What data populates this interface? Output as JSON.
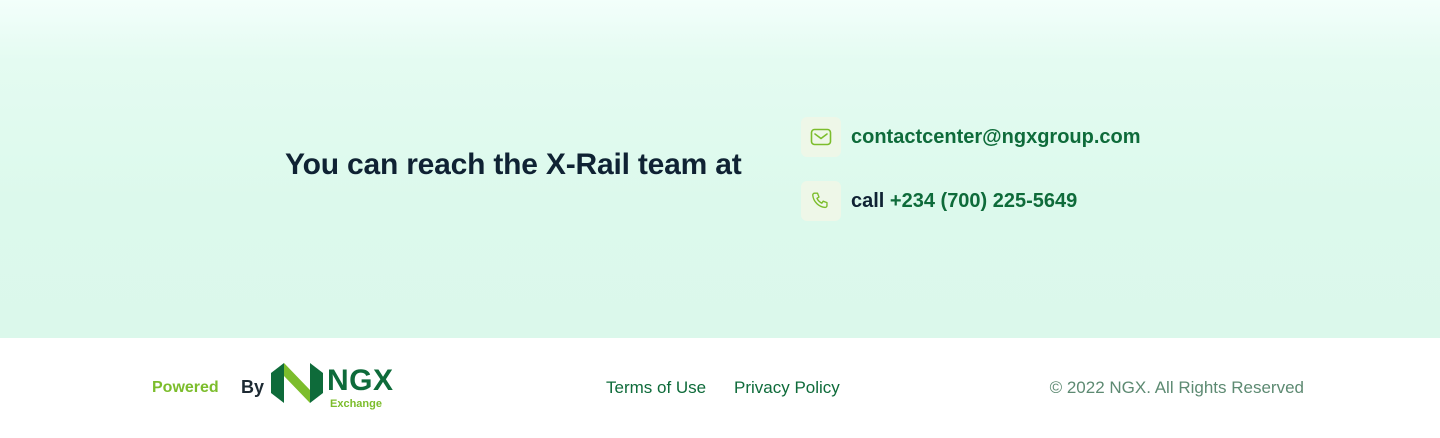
{
  "contact": {
    "heading": "You can reach the X-Rail team at",
    "email": "contactcenter@ngxgroup.com",
    "call_prefix": "call",
    "phone": "+234 (700) 225-5649",
    "email_icon": "mail-icon",
    "phone_icon": "phone-icon"
  },
  "footer": {
    "powered": "Powered",
    "by": "By",
    "logo_text": "NGX",
    "logo_sub": "Exchange",
    "links": [
      {
        "label": "Terms of Use"
      },
      {
        "label": "Privacy Policy"
      }
    ],
    "copyright": "© 2022 NGX. All Rights Reserved"
  },
  "colors": {
    "brand_green": "#0e6b3a",
    "accent_green": "#7cbd2c",
    "heading": "#0f2233"
  }
}
